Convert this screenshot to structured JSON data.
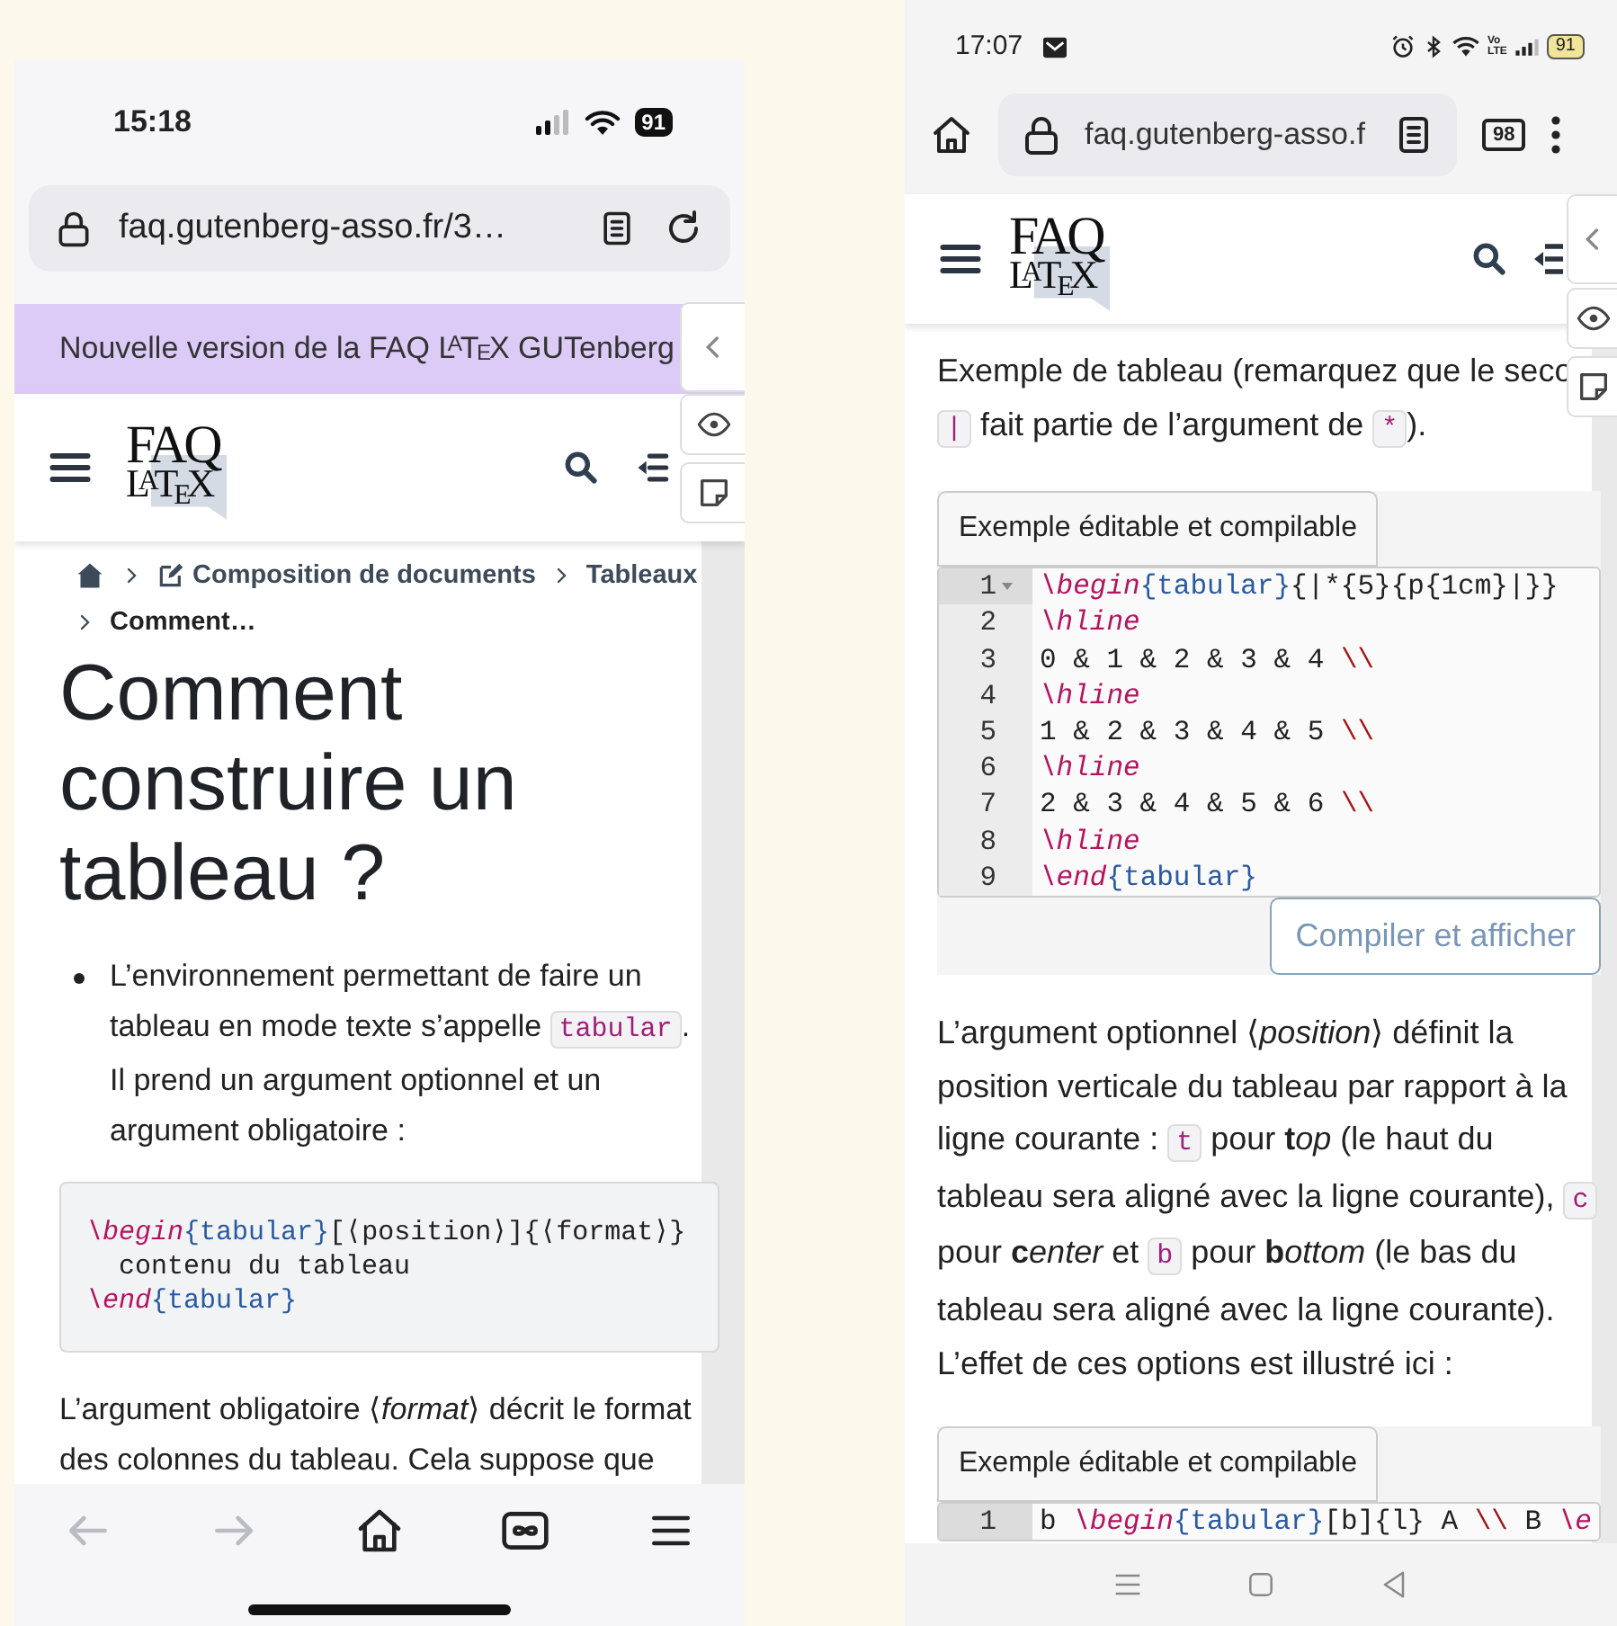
{
  "left_phone": {
    "status_bar": {
      "time": "15:18",
      "battery": "91"
    },
    "address_bar": {
      "url": "faq.gutenberg-asso.fr/3…"
    },
    "banner": {
      "text": "Nouvelle version de la FAQ L$^{A}$T$_{E}$X GUTenberg"
    },
    "logo": {
      "line_1": "FAQ",
      "line_2": "L$^{A}$T$_{E}$X"
    },
    "breadcrumb": [
      {
        "kind": "home"
      },
      {
        "kind": "section",
        "text": "Composition de documents"
      },
      {
        "kind": "link",
        "text": "Tableaux"
      },
      {
        "kind": "current",
        "text": "Comment…"
      }
    ],
    "title": "Comment construire un tableau ?",
    "content": [
      {
        "kind": "bullet",
        "segments": [
          {
            "kind": "text",
            "text": "L’environnement permettant de faire un tableau en mode texte s’appelle "
          },
          {
            "kind": "code",
            "text": "tabular"
          },
          {
            "kind": "text",
            "text": ". Il prend un argument optionnel et un argument obligatoire :"
          }
        ]
      },
      {
        "kind": "code",
        "lines": [
          [
            {
              "kind": "cmd",
              "text": "\\begin"
            },
            {
              "kind": "arg",
              "text": "{tabular}"
            },
            {
              "kind": "plain",
              "text": "[⟨position⟩]{⟨format⟩}"
            }
          ],
          [
            {
              "kind": "plain",
              "text": "  contenu du tableau"
            }
          ],
          [
            {
              "kind": "cmd",
              "text": "\\end"
            },
            {
              "kind": "arg",
              "text": "{tabular}"
            }
          ]
        ]
      },
      {
        "kind": "paragraph",
        "segments": [
          {
            "kind": "text",
            "text": "L’argument obligatoire ⟨*format*⟩ décrit le format des colonnes du tableau. Cela suppose que"
          }
        ]
      }
    ],
    "nav_bar": [
      {
        "kind": "back",
        "disabled": true
      },
      {
        "kind": "forward",
        "disabled": true
      },
      {
        "kind": "home",
        "disabled": false
      },
      {
        "kind": "tabs",
        "disabled": false
      },
      {
        "kind": "menu",
        "disabled": false
      }
    ]
  },
  "right_phone": {
    "status_bar": {
      "time": "17:07",
      "network_badge": [
        "Vo",
        "LTE"
      ],
      "battery": "91"
    },
    "address_bar": {
      "url": "faq.gutenberg-asso.f",
      "tab_count": "98"
    },
    "logo": {
      "line_1": "FAQ",
      "line_2": "L$^{A}$T$_{E}$X"
    },
    "content": [
      {
        "kind": "paragraph",
        "segments": [
          {
            "kind": "text",
            "text": "Exemple de tableau (remarquez que le seco"
          },
          {
            "kind": "break"
          },
          {
            "kind": "code",
            "text": "|"
          },
          {
            "kind": "text",
            "text": " fait partie de l’argument de "
          },
          {
            "kind": "code",
            "text": "*"
          },
          {
            "kind": "text",
            "text": ")."
          }
        ]
      },
      {
        "kind": "editor",
        "tab": "Exemple éditable et compilable",
        "lines": [
          {
            "number": "1",
            "active": true,
            "fold": true,
            "tokens": [
              {
                "kind": "cmd",
                "text": "\\begin"
              },
              {
                "kind": "arg",
                "text": "{tabular}"
              },
              {
                "kind": "plain",
                "text": "{|*{5}{p{1cm}|}}"
              }
            ]
          },
          {
            "number": "2",
            "active": false,
            "fold": false,
            "tokens": [
              {
                "kind": "cmd",
                "text": "\\hline"
              }
            ]
          },
          {
            "number": "3",
            "active": false,
            "fold": false,
            "tokens": [
              {
                "kind": "plain",
                "text": "0 & 1 & 2 & 3 & 4 "
              },
              {
                "kind": "rowend",
                "text": "\\\\"
              }
            ]
          },
          {
            "number": "4",
            "active": false,
            "fold": false,
            "tokens": [
              {
                "kind": "cmd",
                "text": "\\hline"
              }
            ]
          },
          {
            "number": "5",
            "active": false,
            "fold": false,
            "tokens": [
              {
                "kind": "plain",
                "text": "1 & 2 & 3 & 4 & 5 "
              },
              {
                "kind": "rowend",
                "text": "\\\\"
              }
            ]
          },
          {
            "number": "6",
            "active": false,
            "fold": false,
            "tokens": [
              {
                "kind": "cmd",
                "text": "\\hline"
              }
            ]
          },
          {
            "number": "7",
            "active": false,
            "fold": false,
            "tokens": [
              {
                "kind": "plain",
                "text": "2 & 3 & 4 & 5 & 6 "
              },
              {
                "kind": "rowend",
                "text": "\\\\"
              }
            ]
          },
          {
            "number": "8",
            "active": false,
            "fold": false,
            "tokens": [
              {
                "kind": "cmd",
                "text": "\\hline"
              }
            ]
          },
          {
            "number": "9",
            "active": false,
            "fold": false,
            "tokens": [
              {
                "kind": "cmd",
                "text": "\\end"
              },
              {
                "kind": "arg",
                "text": "{tabular}"
              }
            ]
          }
        ],
        "button": "Compiler et afficher"
      },
      {
        "kind": "paragraph",
        "segments": [
          {
            "kind": "text",
            "text": "L’argument optionnel ⟨*position*⟩ définit la position verticale du tableau par rapport à la ligne courante : "
          },
          {
            "kind": "code",
            "text": "t"
          },
          {
            "kind": "text",
            "text": " pour **t**"
          },
          {
            "kind": "text",
            "text": "*op* (le haut du tableau sera aligné avec la ligne courante), "
          },
          {
            "kind": "code",
            "text": "c"
          },
          {
            "kind": "text",
            "text": " pour **c**"
          },
          {
            "kind": "text",
            "text": "*enter* et "
          },
          {
            "kind": "code",
            "text": "b"
          },
          {
            "kind": "text",
            "text": " pour **b**"
          },
          {
            "kind": "text",
            "text": "*ottom* (le bas du tableau sera aligné avec la ligne courante). L’effet de ces options est illustré ici :"
          }
        ]
      },
      {
        "kind": "editor",
        "tab": "Exemple éditable et compilable",
        "lines": [
          {
            "number": "1",
            "active": true,
            "fold": false,
            "tokens": [
              {
                "kind": "plain",
                "text": "b "
              },
              {
                "kind": "cmd",
                "text": "\\begin"
              },
              {
                "kind": "arg",
                "text": "{tabular}"
              },
              {
                "kind": "plain",
                "text": "[b]{l} A "
              },
              {
                "kind": "rowend",
                "text": "\\\\"
              },
              {
                "kind": "plain",
                "text": " B "
              },
              {
                "kind": "cmd",
                "text": "\\e"
              }
            ]
          }
        ]
      }
    ],
    "nav_bar": [
      {
        "kind": "menu"
      },
      {
        "kind": "home"
      },
      {
        "kind": "back"
      }
    ]
  }
}
